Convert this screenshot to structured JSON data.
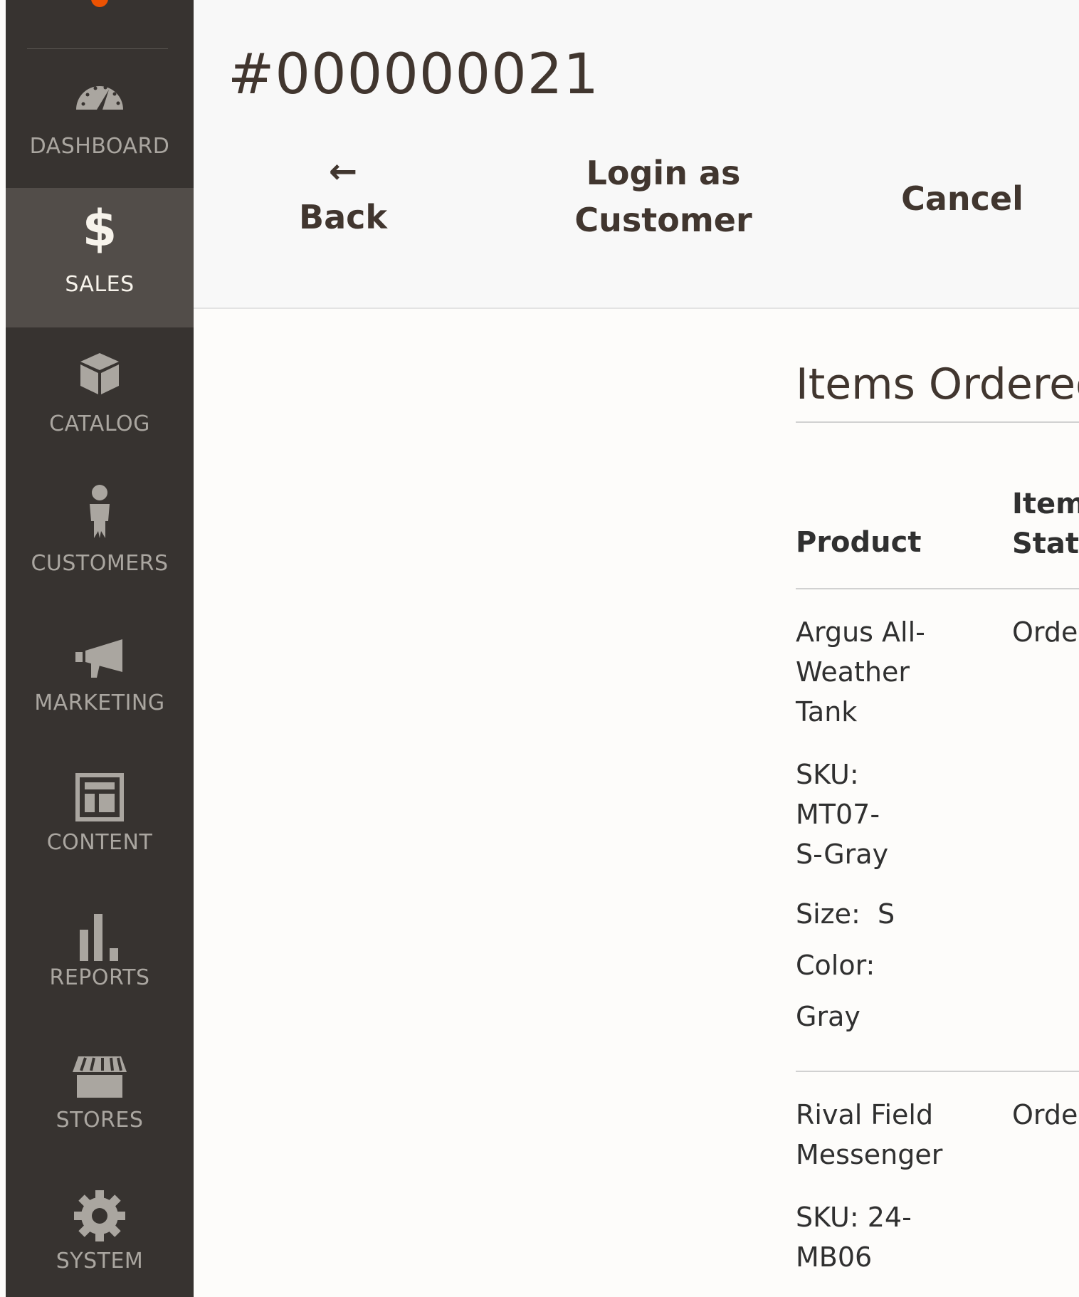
{
  "sidebar": {
    "items": [
      {
        "label": "DASHBOARD",
        "icon": "dashboard-icon",
        "active": false
      },
      {
        "label": "SALES",
        "icon": "dollar-icon",
        "active": true
      },
      {
        "label": "CATALOG",
        "icon": "box-icon",
        "active": false
      },
      {
        "label": "CUSTOMERS",
        "icon": "person-icon",
        "active": false
      },
      {
        "label": "MARKETING",
        "icon": "megaphone-icon",
        "active": false
      },
      {
        "label": "CONTENT",
        "icon": "layout-icon",
        "active": false
      },
      {
        "label": "REPORTS",
        "icon": "bar-chart-icon",
        "active": false
      },
      {
        "label": "STORES",
        "icon": "storefront-icon",
        "active": false
      },
      {
        "label": "SYSTEM",
        "icon": "gear-icon",
        "active": false
      }
    ]
  },
  "header": {
    "title": "#000000021",
    "actions": {
      "back_arrow": "←",
      "back": "Back",
      "login_line1": "Login as",
      "login_line2": "Customer",
      "cancel": "Cancel"
    }
  },
  "items_ordered": {
    "title": "Items Ordered",
    "columns": {
      "product": "Product",
      "status_line1": "Item",
      "status_line2": "Status"
    },
    "rows": [
      {
        "product_lines": [
          "Argus All-",
          "Weather",
          "Tank"
        ],
        "sku_lines": [
          "SKU:",
          "MT07-",
          "S-Gray"
        ],
        "size": "Size:  S",
        "color_label": "Color:",
        "color_value": "Gray",
        "status": "Ordered"
      },
      {
        "product_lines": [
          "Rival Field",
          "Messenger"
        ],
        "sku_lines": [
          "SKU: 24-",
          "MB06"
        ],
        "status": "Ordered"
      }
    ]
  },
  "colors": {
    "sidebar_bg": "#373330",
    "sidebar_active": "#524d49",
    "brand_orange": "#eb5202",
    "header_bg": "#f8f8f8"
  }
}
